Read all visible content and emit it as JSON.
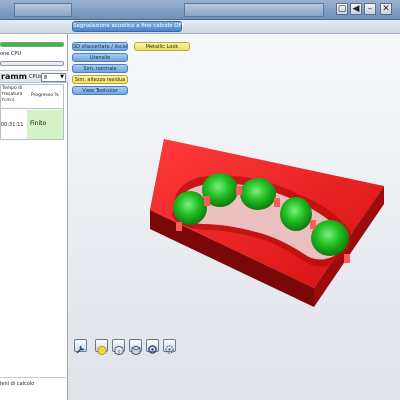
{
  "toolbar": {
    "acoustic_signal_label": "Segnalazione acustica a fine calcolo OFF"
  },
  "left_panel": {
    "cpu_label": "one CPU",
    "program_label": "ramm",
    "cpus_label": "CPUs:",
    "cpus_value": "8",
    "columns": [
      "",
      "Tempo di fresatura h:m:s",
      "Progresso %"
    ],
    "rows": [
      {
        "time": "00:31:11",
        "progress": "Finito"
      }
    ],
    "footer_label": "leni di calcolo"
  },
  "progress": {
    "top_bar": 1.0,
    "second_bar": 0.0
  },
  "view_buttons": {
    "sfaccettato": "3D sfaccettato / liscio",
    "metallic": "Metallic Look",
    "utensile": "Utensile",
    "sim_normale": "Sim. normale",
    "sim_altezza": "Sim. altezza residua",
    "view_toolcolor": "View Toolcolor"
  },
  "bottom_icons": [
    "wrench-icon",
    "yellow-cube-icon",
    "cube-view-icon",
    "cube-view-2-icon",
    "rotate-icon",
    "fit-view-icon"
  ],
  "colors": {
    "progress_green": "#33bb33",
    "tooth_green": "#1fbf1f",
    "block_red": "#e11a1a",
    "button_blue": "#7fb0e6",
    "button_yellow": "#f3e977",
    "row_highlight": "#d6f2c4"
  }
}
